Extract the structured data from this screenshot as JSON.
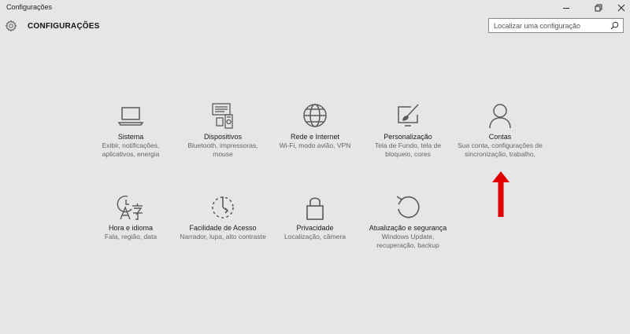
{
  "window": {
    "title": "Configurações"
  },
  "header": {
    "title": "CONFIGURAÇÕES"
  },
  "search": {
    "placeholder": "Localizar uma configuração"
  },
  "categories": [
    {
      "label": "Sistema",
      "desc": "Exibir, notificações, aplicativos, energia",
      "icon": "laptop-icon"
    },
    {
      "label": "Dispositivos",
      "desc": "Bluetooth, impressoras, mouse",
      "icon": "devices-icon"
    },
    {
      "label": "Rede e Internet",
      "desc": "Wi-Fi, modo avião, VPN",
      "icon": "globe-icon"
    },
    {
      "label": "Personalização",
      "desc": "Tela de Fundo, tela de bloqueio, cores",
      "icon": "paint-icon"
    },
    {
      "label": "Contas",
      "desc": "Sua conta, configurações de sincronização, trabalho,",
      "icon": "person-icon"
    },
    {
      "label": "Hora e idioma",
      "desc": "Fala, região, data",
      "icon": "time-language-icon"
    },
    {
      "label": "Facilidade de Acesso",
      "desc": "Narrador, lupa, alto contraste",
      "icon": "ease-of-access-icon"
    },
    {
      "label": "Privacidade",
      "desc": "Localização, câmera",
      "icon": "lock-icon"
    },
    {
      "label": "Atualização e segurança",
      "desc": "Windows Update, recuperação, backup",
      "icon": "update-icon"
    }
  ],
  "colors": {
    "background": "#e6e6e6",
    "icon": "#5a5a5a",
    "annotation_arrow": "#e00000"
  }
}
